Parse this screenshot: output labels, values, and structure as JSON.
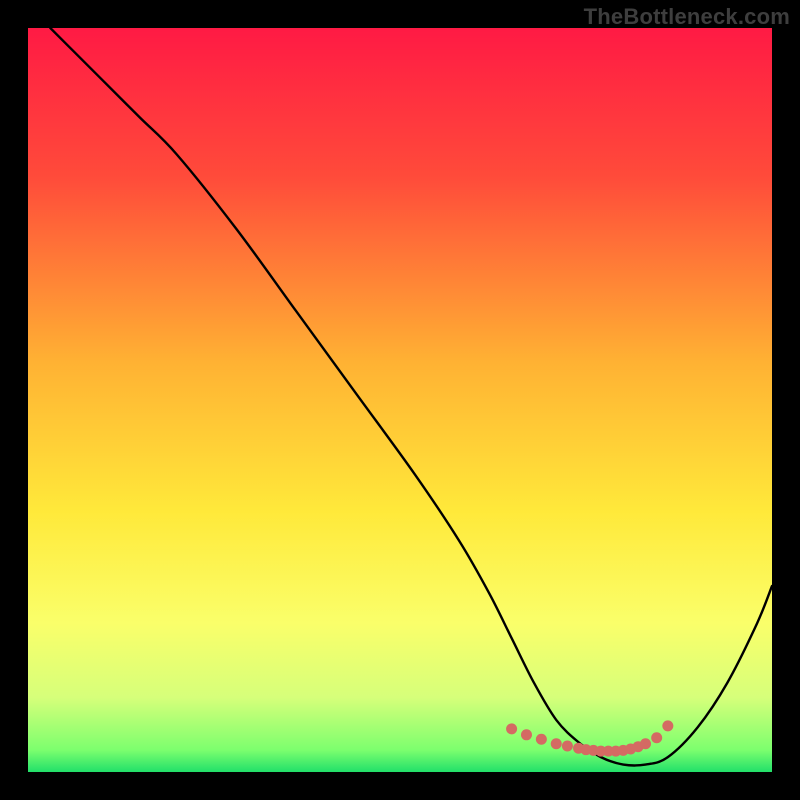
{
  "watermark": "TheBottleneck.com",
  "chart_data": {
    "type": "line",
    "title": "",
    "xlabel": "",
    "ylabel": "",
    "xlim": [
      0,
      100
    ],
    "ylim": [
      0,
      100
    ],
    "gradient_stops": [
      {
        "offset": 0,
        "color": "#ff1a44"
      },
      {
        "offset": 20,
        "color": "#ff4b3a"
      },
      {
        "offset": 45,
        "color": "#ffb233"
      },
      {
        "offset": 65,
        "color": "#ffe93a"
      },
      {
        "offset": 80,
        "color": "#faff6a"
      },
      {
        "offset": 90,
        "color": "#d6ff7a"
      },
      {
        "offset": 97,
        "color": "#7dff6e"
      },
      {
        "offset": 100,
        "color": "#22e06a"
      }
    ],
    "series": [
      {
        "name": "bottleneck-curve",
        "x": [
          3,
          6,
          10,
          15,
          20,
          28,
          36,
          44,
          52,
          58,
          62,
          65,
          68,
          71,
          74,
          77,
          80,
          83,
          86,
          90,
          94,
          98,
          100
        ],
        "y": [
          100,
          97,
          93,
          88,
          83,
          73,
          62,
          51,
          40,
          31,
          24,
          18,
          12,
          7,
          4,
          2,
          1,
          1,
          2,
          6,
          12,
          20,
          25
        ]
      }
    ],
    "markers": {
      "name": "highlight-dots",
      "color": "#d46a63",
      "x": [
        65,
        67,
        69,
        71,
        72.5,
        74,
        75,
        76,
        77,
        78,
        79,
        80,
        81,
        82,
        83,
        84.5,
        86
      ],
      "y": [
        5.8,
        5.0,
        4.4,
        3.8,
        3.5,
        3.2,
        3.0,
        2.9,
        2.8,
        2.8,
        2.8,
        2.9,
        3.1,
        3.4,
        3.8,
        4.6,
        6.2
      ]
    }
  }
}
